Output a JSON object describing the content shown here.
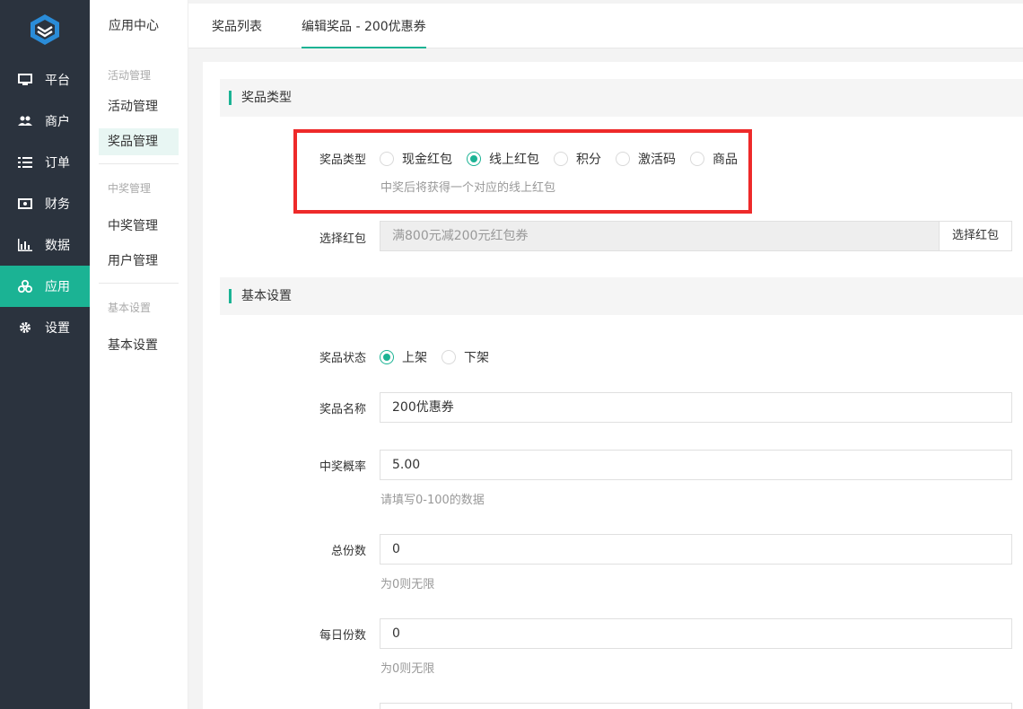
{
  "sidebar": {
    "items": [
      {
        "label": "平台",
        "icon": "monitor-icon"
      },
      {
        "label": "商户",
        "icon": "users-icon"
      },
      {
        "label": "订单",
        "icon": "list-icon"
      },
      {
        "label": "财务",
        "icon": "money-icon"
      },
      {
        "label": "数据",
        "icon": "bar-chart-icon"
      },
      {
        "label": "应用",
        "icon": "apps-icon",
        "active": true
      },
      {
        "label": "设置",
        "icon": "gear-icon"
      }
    ]
  },
  "subnav": {
    "brand": "应用中心",
    "groups": [
      {
        "title": "活动管理",
        "items": [
          "活动管理",
          "奖品管理"
        ]
      },
      {
        "title": "中奖管理",
        "items": [
          "中奖管理",
          "用户管理"
        ]
      },
      {
        "title": "基本设置",
        "items": [
          "基本设置"
        ]
      }
    ]
  },
  "tabs": [
    "奖品列表",
    "编辑奖品 - 200优惠券"
  ],
  "section_type": {
    "title": "奖品类型",
    "label": "奖品类型",
    "options": [
      "现金红包",
      "线上红包",
      "积分",
      "激活码",
      "商品"
    ],
    "selected": "线上红包",
    "hint": "中奖后将获得一个对应的线上红包"
  },
  "redpack": {
    "label": "选择红包",
    "value": "满800元减200元红包券",
    "button": "选择红包"
  },
  "section_basic": {
    "title": "基本设置",
    "status": {
      "label": "奖品状态",
      "options": [
        "上架",
        "下架"
      ],
      "selected": "上架"
    },
    "name": {
      "label": "奖品名称",
      "value": "200优惠券"
    },
    "probability": {
      "label": "中奖概率",
      "value": "5.00",
      "hint": "请填写0-100的数据"
    },
    "total": {
      "label": "总份数",
      "value": "0",
      "hint": "为0则无限"
    },
    "daily": {
      "label": "每日份数",
      "value": "0",
      "hint": "为0则无限"
    }
  },
  "colors": {
    "accent": "#1bb394",
    "sidebar": "#2b333e",
    "highlight": "#ee2a2a"
  }
}
